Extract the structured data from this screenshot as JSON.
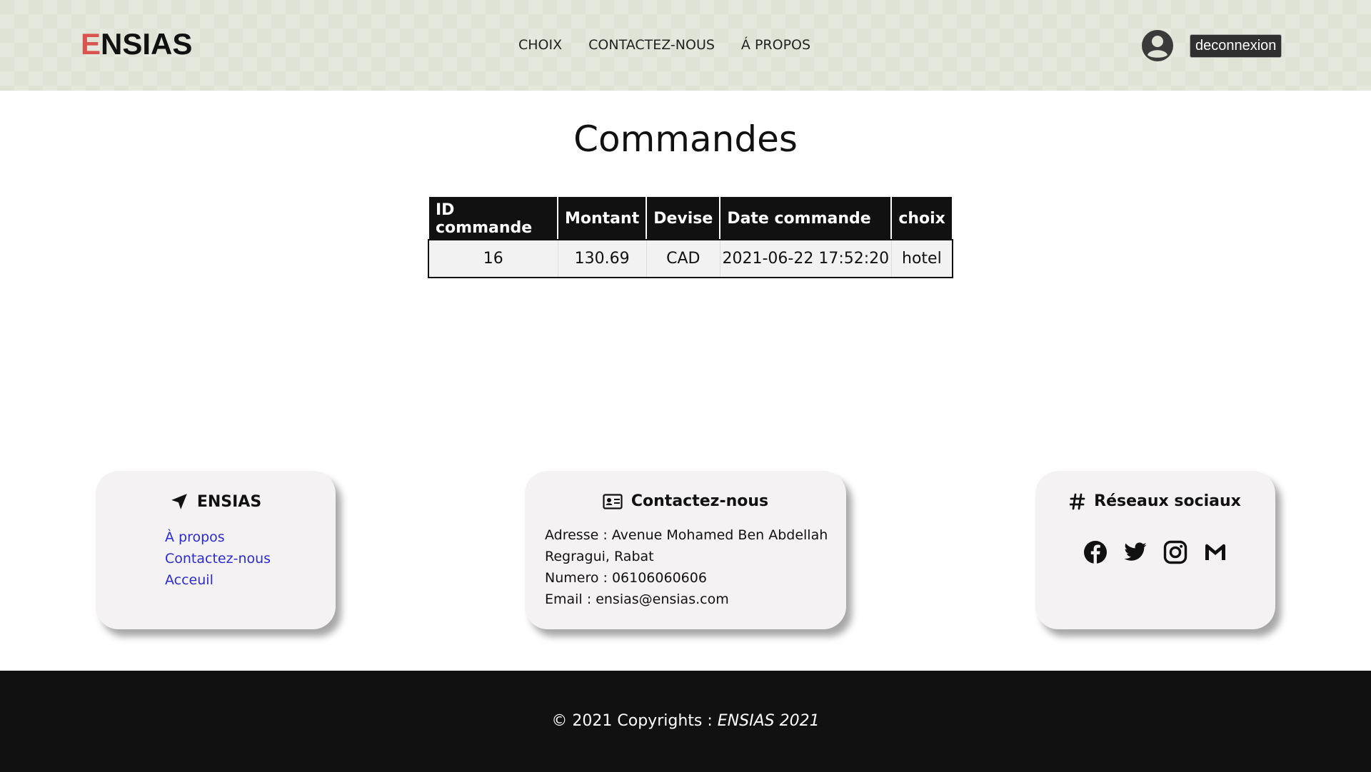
{
  "header": {
    "logo_first": "E",
    "logo_rest": "NSIAS",
    "nav": [
      "CHOIX",
      "CONTACTEZ-NOUS",
      "Á PROPOS"
    ],
    "avatar_icon": "user-circle-icon",
    "logout_label": "deconnexion"
  },
  "main": {
    "title": "Commandes",
    "table": {
      "headers": [
        "ID commande",
        "Montant",
        "Devise",
        "Date commande",
        "choix"
      ],
      "rows": [
        [
          "16",
          "130.69",
          "CAD",
          "2021-06-22 17:52:20",
          "hotel"
        ]
      ]
    }
  },
  "footer": {
    "ensias_card": {
      "icon": "location-arrow-icon",
      "title": "ENSIAS",
      "links": [
        "À propos",
        "Contactez-nous",
        "Acceuil"
      ]
    },
    "contact_card": {
      "icon": "address-card-icon",
      "title": "Contactez-nous",
      "lines": [
        "Adresse : Avenue Mohamed Ben Abdellah Regragui, Rabat",
        "Numero : 06106060606",
        "Email : ensias@ensias.com"
      ]
    },
    "social_card": {
      "icon": "hashtag-icon",
      "title": "Réseaux sociaux",
      "icons": [
        "facebook-icon",
        "twitter-icon",
        "instagram-icon",
        "gmail-icon"
      ]
    },
    "copyright_prefix": "© 2021 Copyrights : ",
    "copyright_brand": "ENSIAS 2021"
  },
  "colors": {
    "header_bg": "#dfe3d6",
    "logo_accent": "#d9534f",
    "link": "#2b2bd6",
    "table_header_bg": "#111111",
    "footer_bar_bg": "#111111"
  }
}
